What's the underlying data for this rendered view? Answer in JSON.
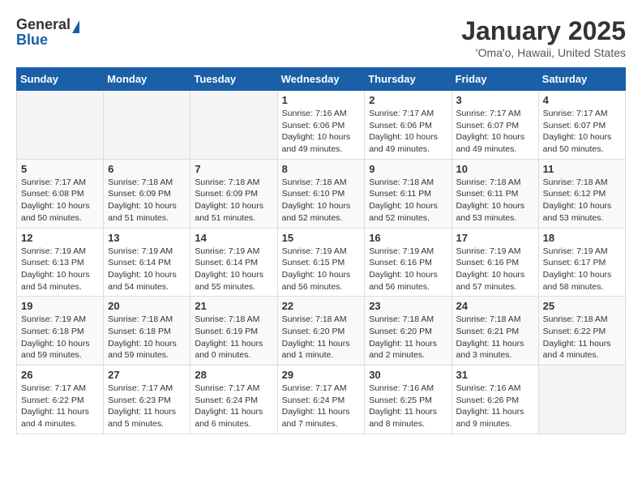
{
  "logo": {
    "general": "General",
    "blue": "Blue"
  },
  "title": "January 2025",
  "subtitle": "'Oma'o, Hawaii, United States",
  "weekdays": [
    "Sunday",
    "Monday",
    "Tuesday",
    "Wednesday",
    "Thursday",
    "Friday",
    "Saturday"
  ],
  "weeks": [
    [
      {
        "day": "",
        "info": ""
      },
      {
        "day": "",
        "info": ""
      },
      {
        "day": "",
        "info": ""
      },
      {
        "day": "1",
        "info": "Sunrise: 7:16 AM\nSunset: 6:06 PM\nDaylight: 10 hours\nand 49 minutes."
      },
      {
        "day": "2",
        "info": "Sunrise: 7:17 AM\nSunset: 6:06 PM\nDaylight: 10 hours\nand 49 minutes."
      },
      {
        "day": "3",
        "info": "Sunrise: 7:17 AM\nSunset: 6:07 PM\nDaylight: 10 hours\nand 49 minutes."
      },
      {
        "day": "4",
        "info": "Sunrise: 7:17 AM\nSunset: 6:07 PM\nDaylight: 10 hours\nand 50 minutes."
      }
    ],
    [
      {
        "day": "5",
        "info": "Sunrise: 7:17 AM\nSunset: 6:08 PM\nDaylight: 10 hours\nand 50 minutes."
      },
      {
        "day": "6",
        "info": "Sunrise: 7:18 AM\nSunset: 6:09 PM\nDaylight: 10 hours\nand 51 minutes."
      },
      {
        "day": "7",
        "info": "Sunrise: 7:18 AM\nSunset: 6:09 PM\nDaylight: 10 hours\nand 51 minutes."
      },
      {
        "day": "8",
        "info": "Sunrise: 7:18 AM\nSunset: 6:10 PM\nDaylight: 10 hours\nand 52 minutes."
      },
      {
        "day": "9",
        "info": "Sunrise: 7:18 AM\nSunset: 6:11 PM\nDaylight: 10 hours\nand 52 minutes."
      },
      {
        "day": "10",
        "info": "Sunrise: 7:18 AM\nSunset: 6:11 PM\nDaylight: 10 hours\nand 53 minutes."
      },
      {
        "day": "11",
        "info": "Sunrise: 7:18 AM\nSunset: 6:12 PM\nDaylight: 10 hours\nand 53 minutes."
      }
    ],
    [
      {
        "day": "12",
        "info": "Sunrise: 7:19 AM\nSunset: 6:13 PM\nDaylight: 10 hours\nand 54 minutes."
      },
      {
        "day": "13",
        "info": "Sunrise: 7:19 AM\nSunset: 6:14 PM\nDaylight: 10 hours\nand 54 minutes."
      },
      {
        "day": "14",
        "info": "Sunrise: 7:19 AM\nSunset: 6:14 PM\nDaylight: 10 hours\nand 55 minutes."
      },
      {
        "day": "15",
        "info": "Sunrise: 7:19 AM\nSunset: 6:15 PM\nDaylight: 10 hours\nand 56 minutes."
      },
      {
        "day": "16",
        "info": "Sunrise: 7:19 AM\nSunset: 6:16 PM\nDaylight: 10 hours\nand 56 minutes."
      },
      {
        "day": "17",
        "info": "Sunrise: 7:19 AM\nSunset: 6:16 PM\nDaylight: 10 hours\nand 57 minutes."
      },
      {
        "day": "18",
        "info": "Sunrise: 7:19 AM\nSunset: 6:17 PM\nDaylight: 10 hours\nand 58 minutes."
      }
    ],
    [
      {
        "day": "19",
        "info": "Sunrise: 7:19 AM\nSunset: 6:18 PM\nDaylight: 10 hours\nand 59 minutes."
      },
      {
        "day": "20",
        "info": "Sunrise: 7:18 AM\nSunset: 6:18 PM\nDaylight: 10 hours\nand 59 minutes."
      },
      {
        "day": "21",
        "info": "Sunrise: 7:18 AM\nSunset: 6:19 PM\nDaylight: 11 hours\nand 0 minutes."
      },
      {
        "day": "22",
        "info": "Sunrise: 7:18 AM\nSunset: 6:20 PM\nDaylight: 11 hours\nand 1 minute."
      },
      {
        "day": "23",
        "info": "Sunrise: 7:18 AM\nSunset: 6:20 PM\nDaylight: 11 hours\nand 2 minutes."
      },
      {
        "day": "24",
        "info": "Sunrise: 7:18 AM\nSunset: 6:21 PM\nDaylight: 11 hours\nand 3 minutes."
      },
      {
        "day": "25",
        "info": "Sunrise: 7:18 AM\nSunset: 6:22 PM\nDaylight: 11 hours\nand 4 minutes."
      }
    ],
    [
      {
        "day": "26",
        "info": "Sunrise: 7:17 AM\nSunset: 6:22 PM\nDaylight: 11 hours\nand 4 minutes."
      },
      {
        "day": "27",
        "info": "Sunrise: 7:17 AM\nSunset: 6:23 PM\nDaylight: 11 hours\nand 5 minutes."
      },
      {
        "day": "28",
        "info": "Sunrise: 7:17 AM\nSunset: 6:24 PM\nDaylight: 11 hours\nand 6 minutes."
      },
      {
        "day": "29",
        "info": "Sunrise: 7:17 AM\nSunset: 6:24 PM\nDaylight: 11 hours\nand 7 minutes."
      },
      {
        "day": "30",
        "info": "Sunrise: 7:16 AM\nSunset: 6:25 PM\nDaylight: 11 hours\nand 8 minutes."
      },
      {
        "day": "31",
        "info": "Sunrise: 7:16 AM\nSunset: 6:26 PM\nDaylight: 11 hours\nand 9 minutes."
      },
      {
        "day": "",
        "info": ""
      }
    ]
  ]
}
